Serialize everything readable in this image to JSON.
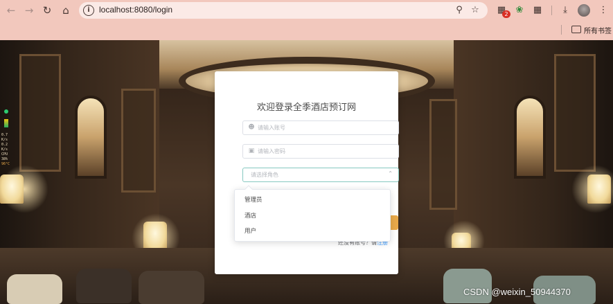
{
  "browser": {
    "url": "localhost:8080/login",
    "bookmarks_label": "所有书签",
    "extension_badge": "2",
    "colors": {
      "chrome": "#f2c8bd",
      "omnibox": "#fbeae6"
    }
  },
  "login": {
    "title": "欢迎登录全季酒店预订网",
    "username_placeholder": "请输入账号",
    "password_placeholder": "请输入密码",
    "role_placeholder": "请选择角色",
    "register_prompt": "还没有账号？请",
    "register_link": "注册",
    "colors": {
      "button": "#e8a94a",
      "link": "#409eff",
      "select_border": "#86c8c0"
    }
  },
  "role_dropdown": {
    "options": [
      "管理员",
      "酒店",
      "用户"
    ]
  },
  "system_monitor": {
    "lines": [
      "0.7",
      "K/s",
      "0.2",
      "K/s",
      "CPU",
      "38%",
      "96°C"
    ]
  },
  "watermark": "CSDN @weixin_50944370"
}
